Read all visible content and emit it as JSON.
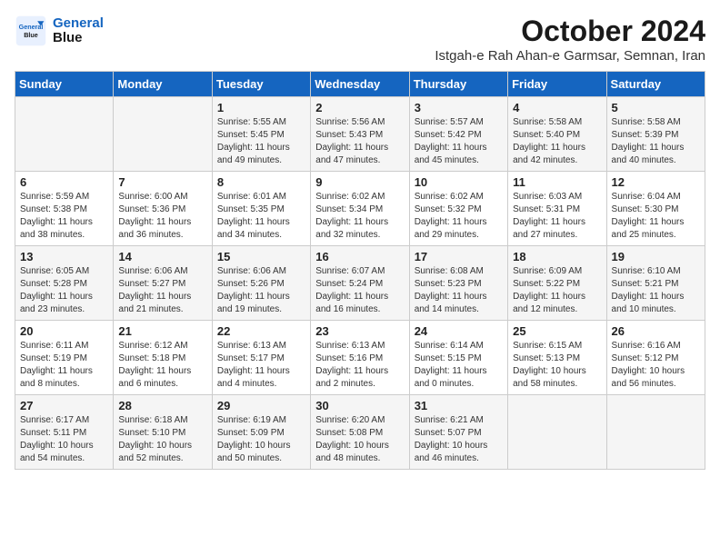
{
  "logo": {
    "text_general": "General",
    "text_blue": "Blue"
  },
  "header": {
    "title": "October 2024",
    "subtitle": "Istgah-e Rah Ahan-e Garmsar, Semnan, Iran"
  },
  "weekdays": [
    "Sunday",
    "Monday",
    "Tuesday",
    "Wednesday",
    "Thursday",
    "Friday",
    "Saturday"
  ],
  "weeks": [
    [
      {
        "day": "",
        "sunrise": "",
        "sunset": "",
        "daylight": ""
      },
      {
        "day": "",
        "sunrise": "",
        "sunset": "",
        "daylight": ""
      },
      {
        "day": "1",
        "sunrise": "Sunrise: 5:55 AM",
        "sunset": "Sunset: 5:45 PM",
        "daylight": "Daylight: 11 hours and 49 minutes."
      },
      {
        "day": "2",
        "sunrise": "Sunrise: 5:56 AM",
        "sunset": "Sunset: 5:43 PM",
        "daylight": "Daylight: 11 hours and 47 minutes."
      },
      {
        "day": "3",
        "sunrise": "Sunrise: 5:57 AM",
        "sunset": "Sunset: 5:42 PM",
        "daylight": "Daylight: 11 hours and 45 minutes."
      },
      {
        "day": "4",
        "sunrise": "Sunrise: 5:58 AM",
        "sunset": "Sunset: 5:40 PM",
        "daylight": "Daylight: 11 hours and 42 minutes."
      },
      {
        "day": "5",
        "sunrise": "Sunrise: 5:58 AM",
        "sunset": "Sunset: 5:39 PM",
        "daylight": "Daylight: 11 hours and 40 minutes."
      }
    ],
    [
      {
        "day": "6",
        "sunrise": "Sunrise: 5:59 AM",
        "sunset": "Sunset: 5:38 PM",
        "daylight": "Daylight: 11 hours and 38 minutes."
      },
      {
        "day": "7",
        "sunrise": "Sunrise: 6:00 AM",
        "sunset": "Sunset: 5:36 PM",
        "daylight": "Daylight: 11 hours and 36 minutes."
      },
      {
        "day": "8",
        "sunrise": "Sunrise: 6:01 AM",
        "sunset": "Sunset: 5:35 PM",
        "daylight": "Daylight: 11 hours and 34 minutes."
      },
      {
        "day": "9",
        "sunrise": "Sunrise: 6:02 AM",
        "sunset": "Sunset: 5:34 PM",
        "daylight": "Daylight: 11 hours and 32 minutes."
      },
      {
        "day": "10",
        "sunrise": "Sunrise: 6:02 AM",
        "sunset": "Sunset: 5:32 PM",
        "daylight": "Daylight: 11 hours and 29 minutes."
      },
      {
        "day": "11",
        "sunrise": "Sunrise: 6:03 AM",
        "sunset": "Sunset: 5:31 PM",
        "daylight": "Daylight: 11 hours and 27 minutes."
      },
      {
        "day": "12",
        "sunrise": "Sunrise: 6:04 AM",
        "sunset": "Sunset: 5:30 PM",
        "daylight": "Daylight: 11 hours and 25 minutes."
      }
    ],
    [
      {
        "day": "13",
        "sunrise": "Sunrise: 6:05 AM",
        "sunset": "Sunset: 5:28 PM",
        "daylight": "Daylight: 11 hours and 23 minutes."
      },
      {
        "day": "14",
        "sunrise": "Sunrise: 6:06 AM",
        "sunset": "Sunset: 5:27 PM",
        "daylight": "Daylight: 11 hours and 21 minutes."
      },
      {
        "day": "15",
        "sunrise": "Sunrise: 6:06 AM",
        "sunset": "Sunset: 5:26 PM",
        "daylight": "Daylight: 11 hours and 19 minutes."
      },
      {
        "day": "16",
        "sunrise": "Sunrise: 6:07 AM",
        "sunset": "Sunset: 5:24 PM",
        "daylight": "Daylight: 11 hours and 16 minutes."
      },
      {
        "day": "17",
        "sunrise": "Sunrise: 6:08 AM",
        "sunset": "Sunset: 5:23 PM",
        "daylight": "Daylight: 11 hours and 14 minutes."
      },
      {
        "day": "18",
        "sunrise": "Sunrise: 6:09 AM",
        "sunset": "Sunset: 5:22 PM",
        "daylight": "Daylight: 11 hours and 12 minutes."
      },
      {
        "day": "19",
        "sunrise": "Sunrise: 6:10 AM",
        "sunset": "Sunset: 5:21 PM",
        "daylight": "Daylight: 11 hours and 10 minutes."
      }
    ],
    [
      {
        "day": "20",
        "sunrise": "Sunrise: 6:11 AM",
        "sunset": "Sunset: 5:19 PM",
        "daylight": "Daylight: 11 hours and 8 minutes."
      },
      {
        "day": "21",
        "sunrise": "Sunrise: 6:12 AM",
        "sunset": "Sunset: 5:18 PM",
        "daylight": "Daylight: 11 hours and 6 minutes."
      },
      {
        "day": "22",
        "sunrise": "Sunrise: 6:13 AM",
        "sunset": "Sunset: 5:17 PM",
        "daylight": "Daylight: 11 hours and 4 minutes."
      },
      {
        "day": "23",
        "sunrise": "Sunrise: 6:13 AM",
        "sunset": "Sunset: 5:16 PM",
        "daylight": "Daylight: 11 hours and 2 minutes."
      },
      {
        "day": "24",
        "sunrise": "Sunrise: 6:14 AM",
        "sunset": "Sunset: 5:15 PM",
        "daylight": "Daylight: 11 hours and 0 minutes."
      },
      {
        "day": "25",
        "sunrise": "Sunrise: 6:15 AM",
        "sunset": "Sunset: 5:13 PM",
        "daylight": "Daylight: 10 hours and 58 minutes."
      },
      {
        "day": "26",
        "sunrise": "Sunrise: 6:16 AM",
        "sunset": "Sunset: 5:12 PM",
        "daylight": "Daylight: 10 hours and 56 minutes."
      }
    ],
    [
      {
        "day": "27",
        "sunrise": "Sunrise: 6:17 AM",
        "sunset": "Sunset: 5:11 PM",
        "daylight": "Daylight: 10 hours and 54 minutes."
      },
      {
        "day": "28",
        "sunrise": "Sunrise: 6:18 AM",
        "sunset": "Sunset: 5:10 PM",
        "daylight": "Daylight: 10 hours and 52 minutes."
      },
      {
        "day": "29",
        "sunrise": "Sunrise: 6:19 AM",
        "sunset": "Sunset: 5:09 PM",
        "daylight": "Daylight: 10 hours and 50 minutes."
      },
      {
        "day": "30",
        "sunrise": "Sunrise: 6:20 AM",
        "sunset": "Sunset: 5:08 PM",
        "daylight": "Daylight: 10 hours and 48 minutes."
      },
      {
        "day": "31",
        "sunrise": "Sunrise: 6:21 AM",
        "sunset": "Sunset: 5:07 PM",
        "daylight": "Daylight: 10 hours and 46 minutes."
      },
      {
        "day": "",
        "sunrise": "",
        "sunset": "",
        "daylight": ""
      },
      {
        "day": "",
        "sunrise": "",
        "sunset": "",
        "daylight": ""
      }
    ]
  ]
}
